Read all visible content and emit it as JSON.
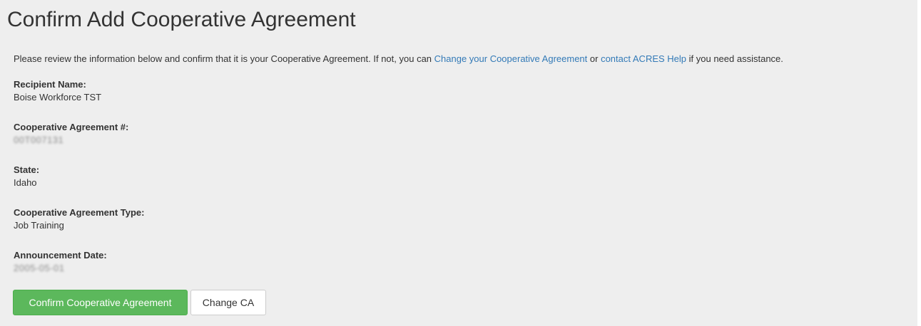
{
  "page": {
    "title": "Confirm Add Cooperative Agreement"
  },
  "intro": {
    "text_before": "Please review the information below and confirm that it is your Cooperative Agreement. If not, you can ",
    "change_link": "Change your Cooperative Agreement",
    "text_middle": " or ",
    "help_link": "contact ACRES Help",
    "text_after": " if you need assistance."
  },
  "fields": {
    "recipient_name": {
      "label": "Recipient Name:",
      "value": "Boise Workforce TST"
    },
    "agreement_number": {
      "label": "Cooperative Agreement #:",
      "value": "00T007131"
    },
    "state": {
      "label": "State:",
      "value": "Idaho"
    },
    "agreement_type": {
      "label": "Cooperative Agreement Type:",
      "value": "Job Training"
    },
    "announcement_date": {
      "label": "Announcement Date:",
      "value": "2005-05-01"
    }
  },
  "buttons": {
    "confirm": "Confirm Cooperative Agreement",
    "change": "Change CA"
  },
  "colors": {
    "link": "#337ab7",
    "confirm_button": "#5cb85c",
    "panel_background": "#eeeeee"
  }
}
